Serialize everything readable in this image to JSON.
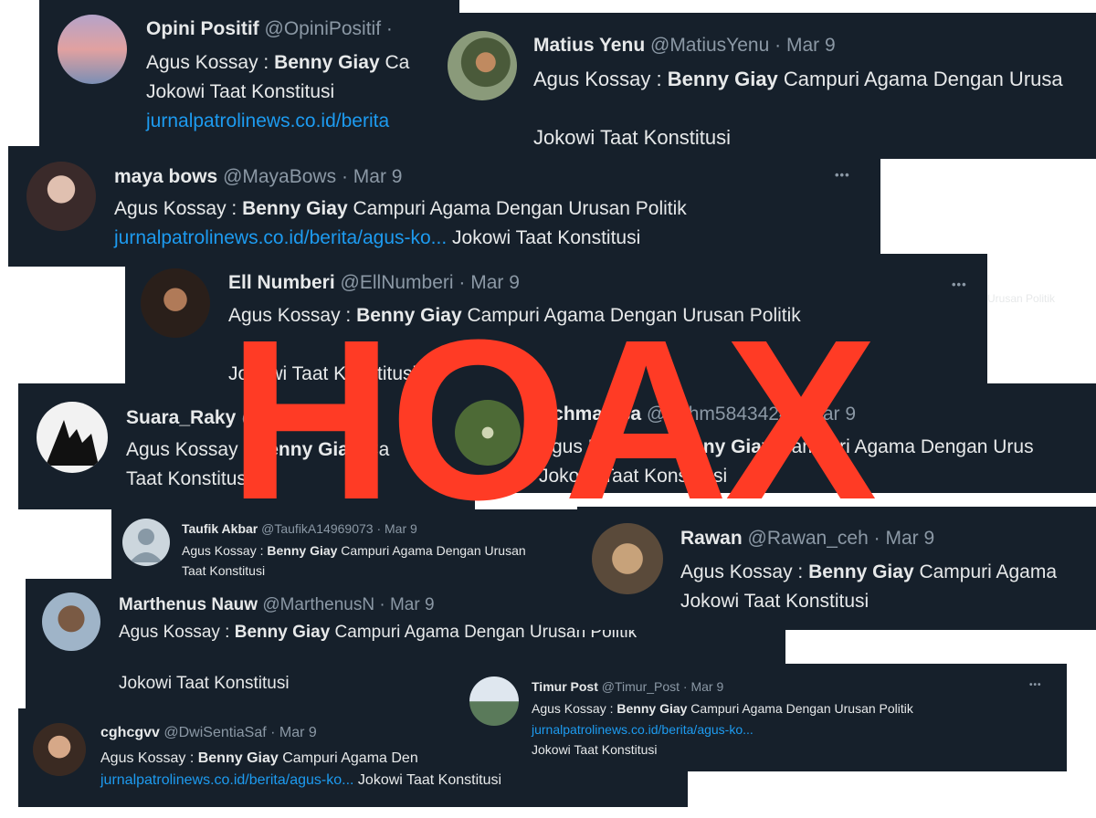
{
  "overlay": {
    "stamp": "HOAX"
  },
  "side_note": "Urusan Politik",
  "tweets": [
    {
      "id": "opini",
      "name": "Opini Positif",
      "handle": "@OpiniPositif",
      "sep": "·",
      "date": "",
      "line1_prefix": "Agus Kossay : ",
      "line1_bold": "Benny Giay",
      "line1_rest": " Ca",
      "line2": "Jokowi Taat Konstitusi",
      "link": "jurnalpatrolinews.co.id/berita"
    },
    {
      "id": "matius",
      "name": "Matius Yenu",
      "handle": "@MatiusYenu",
      "sep": "·",
      "date": "Mar 9",
      "line1_prefix": "Agus Kossay : ",
      "line1_bold": "Benny Giay",
      "line1_rest": " Campuri Agama Dengan Urusa",
      "line2": "Jokowi Taat Konstitusi"
    },
    {
      "id": "maya",
      "name": "maya bows",
      "handle": "@MayaBows",
      "sep": "·",
      "date": "Mar 9",
      "line1_prefix": "Agus Kossay : ",
      "line1_bold": "Benny Giay",
      "line1_rest": " Campuri Agama Dengan Urusan Politik",
      "link": "jurnalpatrolinews.co.id/berita/agus-ko...",
      "line2": " Jokowi Taat Konstitusi",
      "more": "•••"
    },
    {
      "id": "ell",
      "name": "Ell Numberi",
      "handle": "@EllNumberi",
      "sep": "·",
      "date": "Mar 9",
      "line1_prefix": "Agus Kossay : ",
      "line1_bold": "Benny Giay",
      "line1_rest": " Campuri Agama Dengan Urusan Politik",
      "line2": "Jokowi Taat Konstitusi",
      "more": "•••"
    },
    {
      "id": "suara",
      "name": "Suara_Raky",
      "handle": "@HanyaSuara",
      "sep": "",
      "date": "",
      "line1_prefix": "Agus Kossay : ",
      "line1_bold": "Benny Giay",
      "line1_rest": " Ca",
      "line2": "Taat Konstitusi"
    },
    {
      "id": "achmad",
      "name": "Achmad sa",
      "handle": "@Achm",
      "handle_tail": "5843424",
      "sep": "·",
      "date": "Mar 9",
      "line1_prefix": "Agus Kossay : ",
      "line1_bold": "Benny Giay",
      "line1_rest": " Campuri Agama Dengan Urus",
      "line2": "Jokowi Taat Konstitusi"
    },
    {
      "id": "taufik",
      "name": "Taufik Akbar",
      "handle": "@TaufikA14969073",
      "sep": "·",
      "date": "Mar 9",
      "line1_prefix": "Agus Kossay : ",
      "line1_bold": "Benny Giay",
      "line1_rest": " Campuri Agama Dengan Urusan",
      "line2": "Taat Konstitusi"
    },
    {
      "id": "rawan",
      "name": "Rawan",
      "handle": "@Rawan_ceh",
      "sep": "·",
      "date": "Mar 9",
      "line1_prefix": "Agus Kossay : ",
      "line1_bold": "Benny Giay",
      "line1_rest": " Campuri Agama",
      "line2": "Jokowi Taat Konstitusi"
    },
    {
      "id": "marthenus",
      "name": "Marthenus Nauw",
      "handle": "@MarthenusN",
      "sep": "·",
      "date": "Mar 9",
      "line1_prefix": "Agus Kossay : ",
      "line1_bold": "Benny Giay",
      "line1_rest": " Campuri Agama Dengan Urusan Politik",
      "line2": "Jokowi Taat Konstitusi"
    },
    {
      "id": "timur",
      "name": "Timur Post",
      "handle": "@Timur_Post",
      "sep": "·",
      "date": "Mar 9",
      "line1_prefix": "Agus Kossay : ",
      "line1_bold": "Benny Giay",
      "line1_rest": " Campuri Agama Dengan Urusan Politik",
      "link": "jurnalpatrolinews.co.id/berita/agus-ko...",
      "line2": "Jokowi Taat Konstitusi",
      "more": "•••"
    },
    {
      "id": "cghcgvv",
      "name": "cghcgvv",
      "handle": "@DwiSentiaSaf",
      "sep": "·",
      "date": "Mar 9",
      "line1_prefix": "Agus Kossay : ",
      "line1_bold": "Benny Giay",
      "line1_rest": " Campuri Agama Den",
      "link": "jurnalpatrolinews.co.id/berita/agus-ko...",
      "line2": " Jokowi Taat Konstitusi"
    }
  ]
}
